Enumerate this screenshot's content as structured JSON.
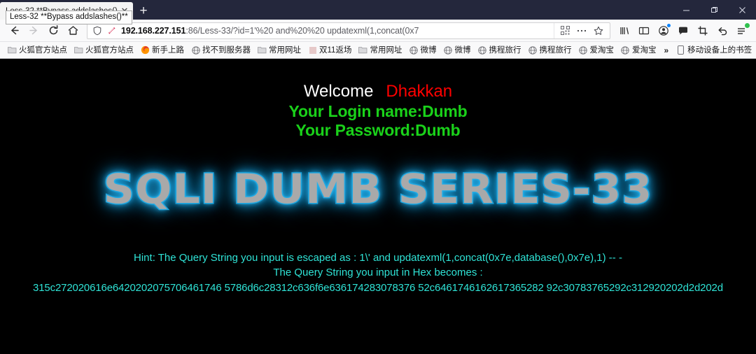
{
  "window": {
    "minimize_label": "—",
    "restore_label": "❐",
    "close_label": "✕"
  },
  "tabs": [
    {
      "title": "Less-32 **Bypass addslashes()**",
      "close_label": "✕"
    }
  ],
  "tab_tooltip": "Less-32 **Bypass addslashes()**",
  "newtab_label": "+",
  "nav": {
    "back": "back-arrow",
    "forward": "forward-arrow",
    "reload": "reload-arrow",
    "home": "home-house"
  },
  "url": {
    "host": "192.168.227.151",
    "rest": ":86/Less-33/?id=1'%20 and%20%20 updatexml(1,concat(0x7",
    "full": "192.168.227.151:86/Less-33/?id=1'%20 and%20%20 updatexml(1,concat(0x7",
    "shield_icon": "shield-icon",
    "tracker_icon": "tracker-blocked-icon",
    "qr_icon": "qr-code-icon",
    "more_icon": "ellipsis-icon",
    "bookmark_icon": "star-icon"
  },
  "toolbar_right": [
    {
      "name": "library-icon",
      "glyph": "library"
    },
    {
      "name": "sidebar-icon",
      "glyph": "sidebar"
    },
    {
      "name": "account-icon",
      "glyph": "account"
    },
    {
      "name": "chat-icon",
      "glyph": "chat"
    },
    {
      "name": "screenshot-icon",
      "glyph": "crop"
    },
    {
      "name": "undo-icon",
      "glyph": "undo"
    },
    {
      "name": "menu-icon",
      "glyph": "menu"
    }
  ],
  "bookmarks": [
    {
      "label": "火狐官方站点",
      "icon": "folder-icon"
    },
    {
      "label": "火狐官方站点",
      "icon": "folder-icon"
    },
    {
      "label": "新手上路",
      "icon": "firefox-icon"
    },
    {
      "label": "找不到服务器",
      "icon": "globe-icon"
    },
    {
      "label": "常用网址",
      "icon": "folder-icon"
    },
    {
      "label": "双11返场",
      "icon": "page-icon"
    },
    {
      "label": "常用网址",
      "icon": "folder-icon"
    },
    {
      "label": "微博",
      "icon": "globe-icon"
    },
    {
      "label": "微博",
      "icon": "globe-icon"
    },
    {
      "label": "携程旅行",
      "icon": "globe-icon"
    },
    {
      "label": "携程旅行",
      "icon": "globe-icon"
    },
    {
      "label": "爱淘宝",
      "icon": "globe-icon"
    },
    {
      "label": "爱淘宝",
      "icon": "globe-icon"
    }
  ],
  "bookmarks_overflow_label": "»",
  "mobile_bookmarks": {
    "label": "移动设备上的书签",
    "icon": "mobile-icon"
  },
  "page": {
    "welcome_label": "Welcome",
    "user_label": "Dhakkan",
    "login_line": "Your Login name:Dumb",
    "password_line": "Your Password:Dumb",
    "banner": "SQLI DUMB SERIES-33",
    "hint_line1": "Hint: The Query String you input is escaped as : 1\\' and updatexml(1,concat(0x7e,database(),0x7e),1) -- -",
    "hint_line2": "The Query String you input in Hex becomes :",
    "hex_line": "315c272020616e6420202075706461746 5786d6c28312c636f6e636174283078376 52c6461746162617365282 92c30783765292c312920202d2d202d"
  },
  "colors": {
    "welcome_white": "#ffffff",
    "user_red": "#fe0000",
    "credentials_green": "#1ad11a",
    "hint_cyan": "#2fe3d6",
    "banner_glow": "#29b6ef",
    "banner_fill": "#a9a9a9",
    "titlebar": "#24273c",
    "page_background": "#000000"
  }
}
